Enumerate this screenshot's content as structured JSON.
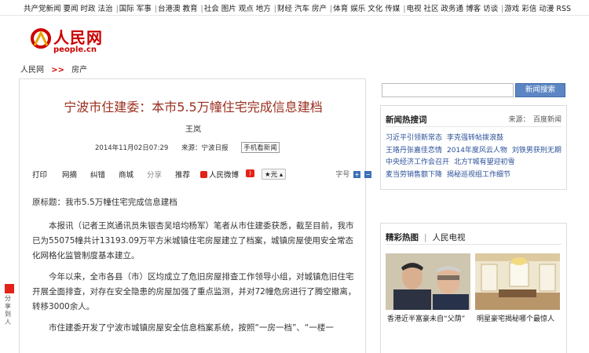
{
  "topnav": {
    "groups": [
      [
        "共产党新闻",
        "要闻",
        "时政",
        "法治"
      ],
      [
        "国际",
        "军事"
      ],
      [
        "台港澳",
        "教育"
      ],
      [
        "社会",
        "图片",
        "观点",
        "地方"
      ],
      [
        "财经",
        "汽车",
        "房产"
      ],
      [
        "体育",
        "娱乐",
        "文化",
        "传媒"
      ],
      [
        "电视",
        "社区",
        "政务通",
        "博客",
        "访谈"
      ],
      [
        "游戏",
        "彩信",
        "动漫",
        "RSS"
      ]
    ]
  },
  "logo": {
    "cn": "人民网",
    "en": "people.cn"
  },
  "breadcrumb": {
    "home": "人民网",
    "arrow": ">>",
    "section": "房产"
  },
  "article": {
    "title": "宁波市住建委：本市5.5万幢住宅完成信息建档",
    "author": "王岚",
    "date": "2014年11月02日07:29",
    "source": "来源：宁波日报",
    "mobile": "手机看新闻",
    "toolbar": {
      "print": "打印",
      "email": "网摘",
      "correct": "纠错",
      "biz": "商城",
      "share": "分享",
      "recommend": "推荐",
      "weibo": "人民微博",
      "fav": "★光",
      "fontsize": "字号",
      "plus": "+",
      "minus": "−"
    },
    "paragraphs": [
      "原标题：我市5.5万幢住宅完成信息建档",
      "本报讯（记者王岚通讯员朱银杏吴培均杨军）笔者从市住建委获悉，截至目前，我市已为55075幢共计13193.09万平方米城镇住宅房屋建立了档案，城镇房屋使用安全常态化网格化监管制度基本建立。",
      "今年以来，全市各县（市）区均成立了危旧房屋排查工作领导小组，对城镇危旧住宅开展全面排查，对存在安全隐患的房屋加强了重点监测，并对72幢危房进行了腾空撤离，转移3000余人。",
      "市住建委开发了宁波市城镇房屋安全信息档案系统，按照“一房一档”、“一楼一"
    ]
  },
  "sidebar": {
    "search_button": "新闻搜索",
    "hot": {
      "title": "新闻热搜词",
      "source": "来源：　百度新闻",
      "rows": [
        [
          "习近平引领新常态",
          "李克强转帖拨浪鼓"
        ],
        [
          "王珞丹张嘉佳恋情",
          "2014年度风云人物",
          "刘铁男获刑无期"
        ],
        [
          "中央经济工作会召开",
          "北方T城有望迎初雪"
        ],
        [
          "麦当劳销售额下降",
          "揭秘巡视组工作细节"
        ]
      ]
    },
    "pics": {
      "tab_active": "精彩热图",
      "tab_other": "人民电视",
      "captions": [
        "香港近半富豪未自“父荫”",
        "明星豪宅揭秘哪个最惊人"
      ]
    }
  },
  "sideshare": {
    "text": "分享到人"
  }
}
